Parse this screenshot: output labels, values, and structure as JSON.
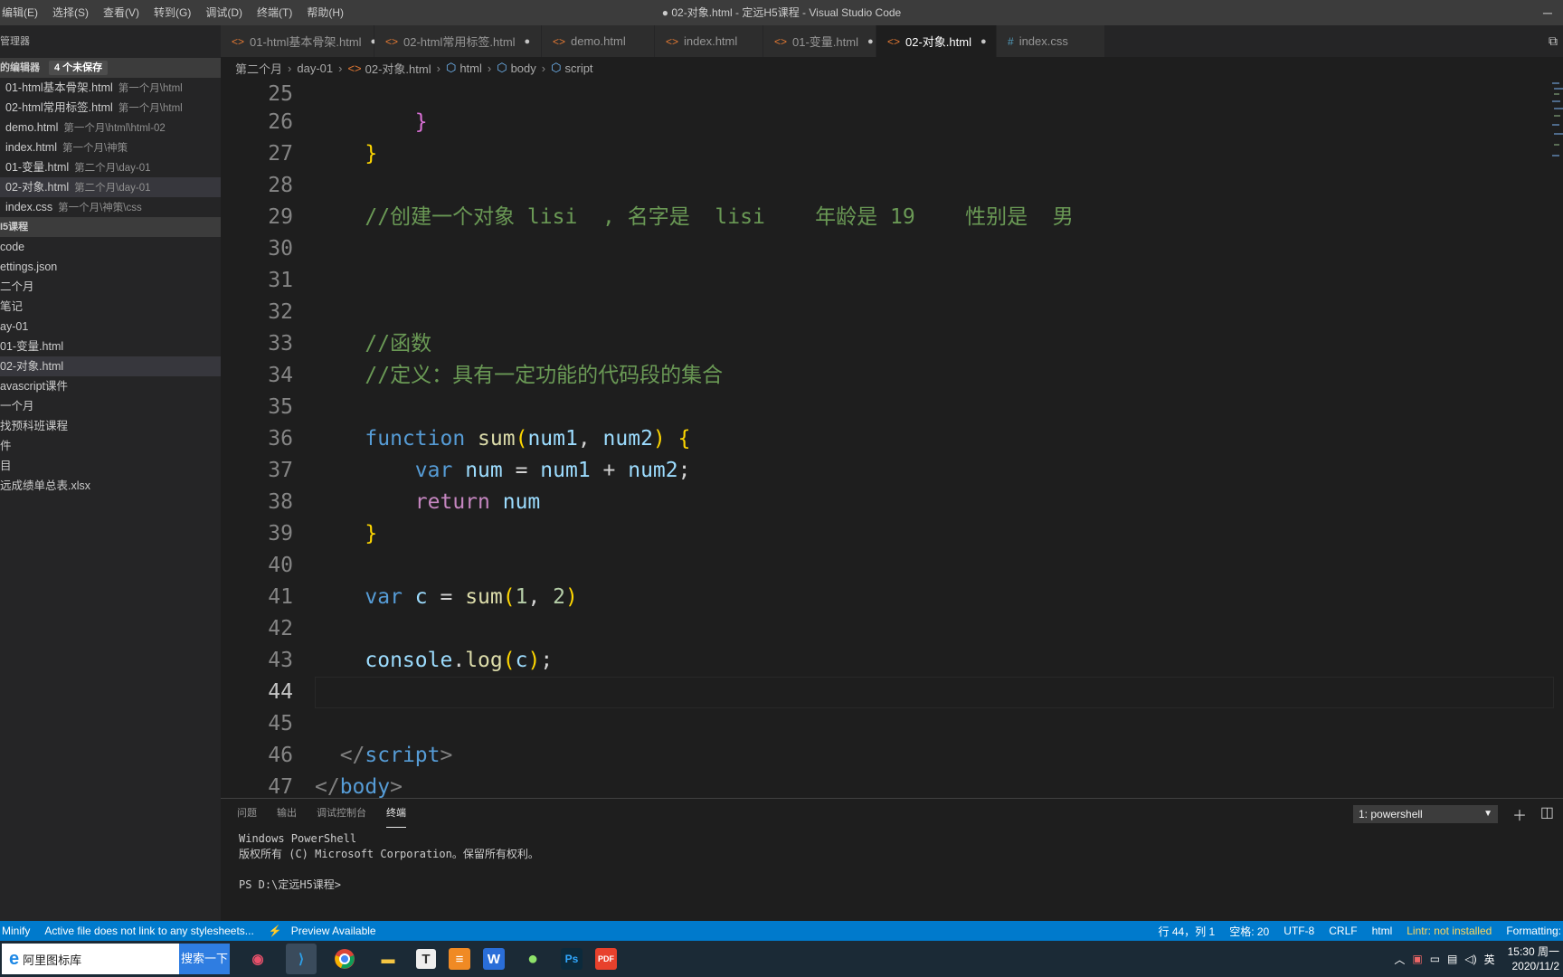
{
  "menu": [
    "编辑(E)",
    "选择(S)",
    "查看(V)",
    "转到(G)",
    "调试(D)",
    "终端(T)",
    "帮助(H)"
  ],
  "window_title": "● 02-对象.html - 定远H5课程 - Visual Studio Code",
  "sidebar": {
    "header": "管理器",
    "open_editors_label": "的编辑器",
    "unsaved_badge": "4 个未保存",
    "open_editors": [
      {
        "name": "01-html基本骨架.html",
        "desc": "第一个月\\html"
      },
      {
        "name": "02-html常用标签.html",
        "desc": "第一个月\\html"
      },
      {
        "name": "demo.html",
        "desc": "第一个月\\html\\html-02"
      },
      {
        "name": "index.html",
        "desc": "第一个月\\神策"
      },
      {
        "name": "01-变量.html",
        "desc": "第二个月\\day-01"
      },
      {
        "name": "02-对象.html",
        "desc": "第二个月\\day-01"
      },
      {
        "name": "index.css",
        "desc": "第一个月\\神策\\css"
      }
    ],
    "folder_label": "I5课程",
    "tree": [
      "code",
      "ettings.json",
      "二个月",
      "笔记",
      "ay-01",
      "01-变量.html",
      "02-对象.html",
      "avascript课件",
      "一个月",
      "找预科班课程",
      "件",
      "目",
      "远成绩单总表.xlsx"
    ]
  },
  "tabs": [
    {
      "label": "01-html基本骨架.html",
      "dirty": "●",
      "icon": "<>"
    },
    {
      "label": "02-html常用标签.html",
      "dirty": "●",
      "icon": "<>"
    },
    {
      "label": "demo.html",
      "dirty": "",
      "icon": "<>"
    },
    {
      "label": "index.html",
      "dirty": "",
      "icon": "<>"
    },
    {
      "label": "01-变量.html",
      "dirty": "●",
      "icon": "<>"
    },
    {
      "label": "02-对象.html",
      "dirty": "●",
      "icon": "<>"
    },
    {
      "label": "index.css",
      "dirty": "",
      "icon": "#"
    }
  ],
  "breadcrumb": [
    "第二个月",
    "day-01",
    "02-对象.html",
    "html",
    "body",
    "script"
  ],
  "editor": {
    "line_numbers": [
      "25",
      "26",
      "27",
      "28",
      "29",
      "30",
      "31",
      "32",
      "33",
      "34",
      "35",
      "36",
      "37",
      "38",
      "39",
      "40",
      "41",
      "42",
      "43",
      "44",
      "45",
      "46",
      "47"
    ],
    "comment_29": "//创建一个对象 lisi  , 名字是  lisi    年龄是 19    性别是  男",
    "comment_33": "//函数",
    "comment_34": "//定义：具有一定功能的代码段的集合",
    "kw_function": "function",
    "fn_sum": "sum",
    "param1": "num1",
    "param2": "num2",
    "kw_var": "var",
    "var_num": "num",
    "kw_return": "return",
    "var_c": "c",
    "arg1": "1",
    "arg2": "2",
    "console": "console",
    "log": "log",
    "tag_script": "script",
    "tag_body": "body"
  },
  "panel": {
    "tabs": [
      "问题",
      "输出",
      "调试控制台",
      "终端"
    ],
    "terminal_select": "1: powershell",
    "terminal_lines": [
      "Windows PowerShell",
      "版权所有 (C) Microsoft Corporation。保留所有权利。",
      "",
      "PS D:\\定远H5课程>"
    ]
  },
  "status": {
    "left": [
      "Minify",
      "Active file does not link to any stylesheets...",
      "⚡",
      "Preview Available"
    ],
    "position": "行 44，列 1",
    "spaces": "空格: 20",
    "encoding": "UTF-8",
    "eol": "CRLF",
    "language": "html",
    "lint": "Lintr: not installed",
    "formatting": "Formatting:"
  },
  "taskbar": {
    "search_text": "阿里图标库",
    "search_button": "搜索一下",
    "ime": "英",
    "time": "15:30 周一",
    "date": "2020/11/2"
  },
  "colors": {
    "accent": "#007acc",
    "keyword": "#569cd6",
    "function": "#dcdcaa",
    "variable": "#9cdcfe",
    "comment": "#6a9955",
    "number": "#b5cea8"
  }
}
